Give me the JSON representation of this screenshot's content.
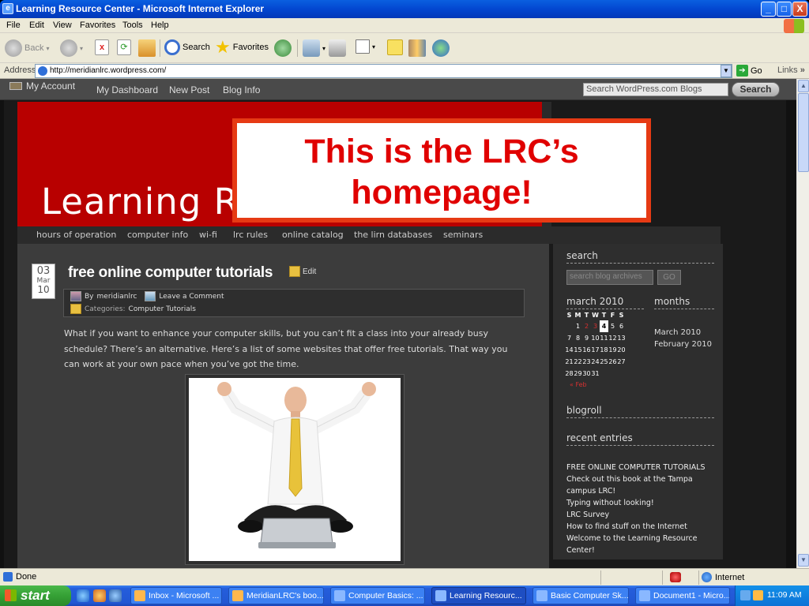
{
  "window": {
    "title": "Learning Resource Center - Microsoft Internet Explorer",
    "controls": {
      "minimize": "_",
      "maximize": "□",
      "close": "X"
    }
  },
  "menubar": [
    "File",
    "Edit",
    "View",
    "Favorites",
    "Tools",
    "Help"
  ],
  "toolbar": {
    "back": "Back",
    "search": "Search",
    "favorites": "Favorites"
  },
  "address": {
    "label": "Address",
    "url": "http://meridianlrc.wordpress.com/",
    "go": "Go",
    "links": "Links"
  },
  "wpbar": {
    "account": "My Account",
    "nav": [
      "My Dashboard",
      "New Post",
      "Blog Info"
    ],
    "search_placeholder": "Search WordPress.com Blogs",
    "search_button": "Search"
  },
  "header": {
    "site_title_visible": "Learning Re"
  },
  "callout": {
    "line1": "This is the LRC’s",
    "line2": "homepage!"
  },
  "category_nav": [
    "hours of operation",
    "computer info",
    "wi-fi",
    "lrc rules",
    "online catalog",
    "the lirn databases",
    "seminars"
  ],
  "post": {
    "date": {
      "day": "03",
      "month": "Mar",
      "year": "10"
    },
    "title": "free online computer tutorials",
    "edit": "Edit",
    "by_prefix": "By",
    "author": "meridianlrc",
    "comment": "Leave a Comment",
    "categories_prefix": "Categories:",
    "category": "Computer Tutorials",
    "body": "What if you want to enhance your computer skills, but you can’t fit a class into your already busy schedule? There’s an alternative. Here’s a list of some websites that offer free tutorials. That way you can work at your own pace when you’ve got the time."
  },
  "sidebar": {
    "search_heading": "search",
    "search_placeholder": "search blog archives",
    "search_go": "GO",
    "calendar_heading": "march 2010",
    "calendar_days": [
      "S",
      "M",
      "T",
      "W",
      "T",
      "F",
      "S"
    ],
    "calendar_weeks": [
      [
        "",
        "1",
        "2",
        "3",
        "4",
        "5",
        "6"
      ],
      [
        "7",
        "8",
        "9",
        "10",
        "11",
        "12",
        "13"
      ],
      [
        "14",
        "15",
        "16",
        "17",
        "18",
        "19",
        "20"
      ],
      [
        "21",
        "22",
        "23",
        "24",
        "25",
        "26",
        "27"
      ],
      [
        "28",
        "29",
        "30",
        "31",
        "",
        "",
        ""
      ]
    ],
    "calendar_today": "4",
    "calendar_linked": [
      "2",
      "3"
    ],
    "calendar_prev": "« Feb",
    "months_heading": "months",
    "months": [
      "March 2010",
      "February 2010"
    ],
    "blogroll_heading": "blogroll",
    "recent_heading": "recent entries",
    "recent": [
      "FREE ONLINE COMPUTER TUTORIALS",
      "Check out this book at the Tampa campus LRC!",
      "Typing without looking!",
      "LRC Survey",
      "How to find stuff on the Internet",
      "Welcome to the Learning Resource Center!"
    ]
  },
  "status": {
    "text": "Done",
    "zone": "Internet"
  },
  "taskbar": {
    "start": "start",
    "tasks": [
      {
        "label": "Inbox - Microsoft ...",
        "active": false
      },
      {
        "label": "MeridianLRC's boo...",
        "active": false
      },
      {
        "label": "Computer Basics: ...",
        "active": false
      },
      {
        "label": "Learning Resourc...",
        "active": true
      },
      {
        "label": "Basic Computer Sk...",
        "active": false
      },
      {
        "label": "Document1 - Micro...",
        "active": false
      }
    ],
    "clock": "11:09 AM"
  },
  "colors": {
    "header_red": "#b80000",
    "callout_border": "#e63a14",
    "callout_text": "#e00000",
    "xp_blue": "#0347d0"
  }
}
